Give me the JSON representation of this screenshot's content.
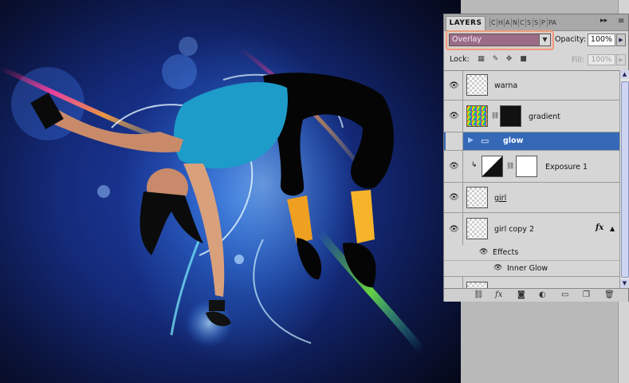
{
  "panel": {
    "active_tab": "LAYERS",
    "minimized_tabs": [
      "C",
      "H",
      "A",
      "N",
      "C",
      "S",
      "S",
      "P",
      "PA"
    ],
    "menu_arrows": "▸▸",
    "menu_icon": "≡"
  },
  "blend": {
    "mode": "Overlay",
    "opacity_label": "Opacity:",
    "opacity": "100%"
  },
  "lock": {
    "label": "Lock:",
    "fill_label": "Fill:",
    "fill": "100%"
  },
  "layers": [
    {
      "name": "warna",
      "visible": true
    },
    {
      "name": "gradient",
      "visible": true
    },
    {
      "name": "glow",
      "visible": false,
      "type": "group",
      "selected": true
    },
    {
      "name": "Exposure 1",
      "visible": true,
      "type": "adjustment"
    },
    {
      "name": "girl",
      "visible": true
    },
    {
      "name": "girl copy 2",
      "visible": true,
      "fx": "fx"
    }
  ],
  "effects": {
    "label": "Effects",
    "items": [
      "Inner Glow"
    ]
  },
  "footer_icons": [
    "link-icon",
    "fx-icon",
    "mask-icon",
    "adjustment-icon",
    "group-icon",
    "new-layer-icon",
    "trash-icon"
  ],
  "colors": {
    "selection": "#3569b8",
    "blend_highlight": "#f19a7e",
    "blend_field": "#9c6b86"
  }
}
